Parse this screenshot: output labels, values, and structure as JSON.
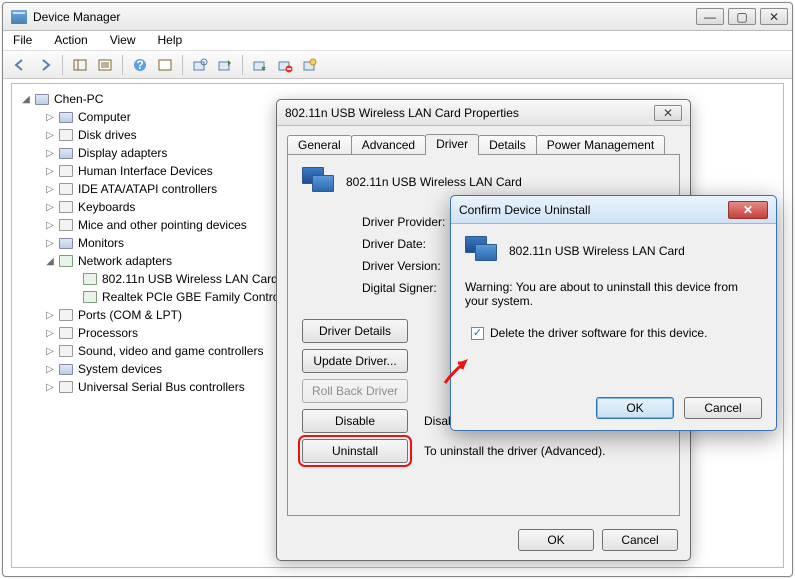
{
  "window": {
    "title": "Device Manager",
    "min": "—",
    "max": "▢",
    "close": "✕"
  },
  "menu": {
    "file": "File",
    "action": "Action",
    "view": "View",
    "help": "Help"
  },
  "tree": {
    "root": "Chen-PC",
    "items": [
      "Computer",
      "Disk drives",
      "Display adapters",
      "Human Interface Devices",
      "IDE ATA/ATAPI controllers",
      "Keyboards",
      "Mice and other pointing devices",
      "Monitors",
      "Network adapters",
      "Ports (COM & LPT)",
      "Processors",
      "Sound, video and game controllers",
      "System devices",
      "Universal Serial Bus controllers"
    ],
    "net_children": [
      "802.11n USB Wireless LAN Card",
      "Realtek PCIe GBE Family Controller"
    ]
  },
  "props": {
    "title": "802.11n USB Wireless LAN Card Properties",
    "tabs": {
      "general": "General",
      "advanced": "Advanced",
      "driver": "Driver",
      "details": "Details",
      "pm": "Power Management"
    },
    "device_name": "802.11n USB Wireless LAN Card",
    "labels": {
      "provider": "Driver Provider:",
      "date": "Driver Date:",
      "version": "Driver Version:",
      "signer": "Digital Signer:"
    },
    "buttons": {
      "details": "Driver Details",
      "update": "Update Driver...",
      "rollback": "Roll Back Driver",
      "disable": "Disable",
      "uninstall": "Uninstall"
    },
    "desc": {
      "disable": "Disables the selected device.",
      "uninstall": "To uninstall the driver (Advanced)."
    },
    "ok": "OK",
    "cancel": "Cancel",
    "close": "✕"
  },
  "confirm": {
    "title": "Confirm Device Uninstall",
    "device": "802.11n USB Wireless LAN Card",
    "warning": "Warning: You are about to uninstall this device from your system.",
    "checkbox": "Delete the driver software for this device.",
    "ok": "OK",
    "cancel": "Cancel",
    "close": "✕"
  }
}
